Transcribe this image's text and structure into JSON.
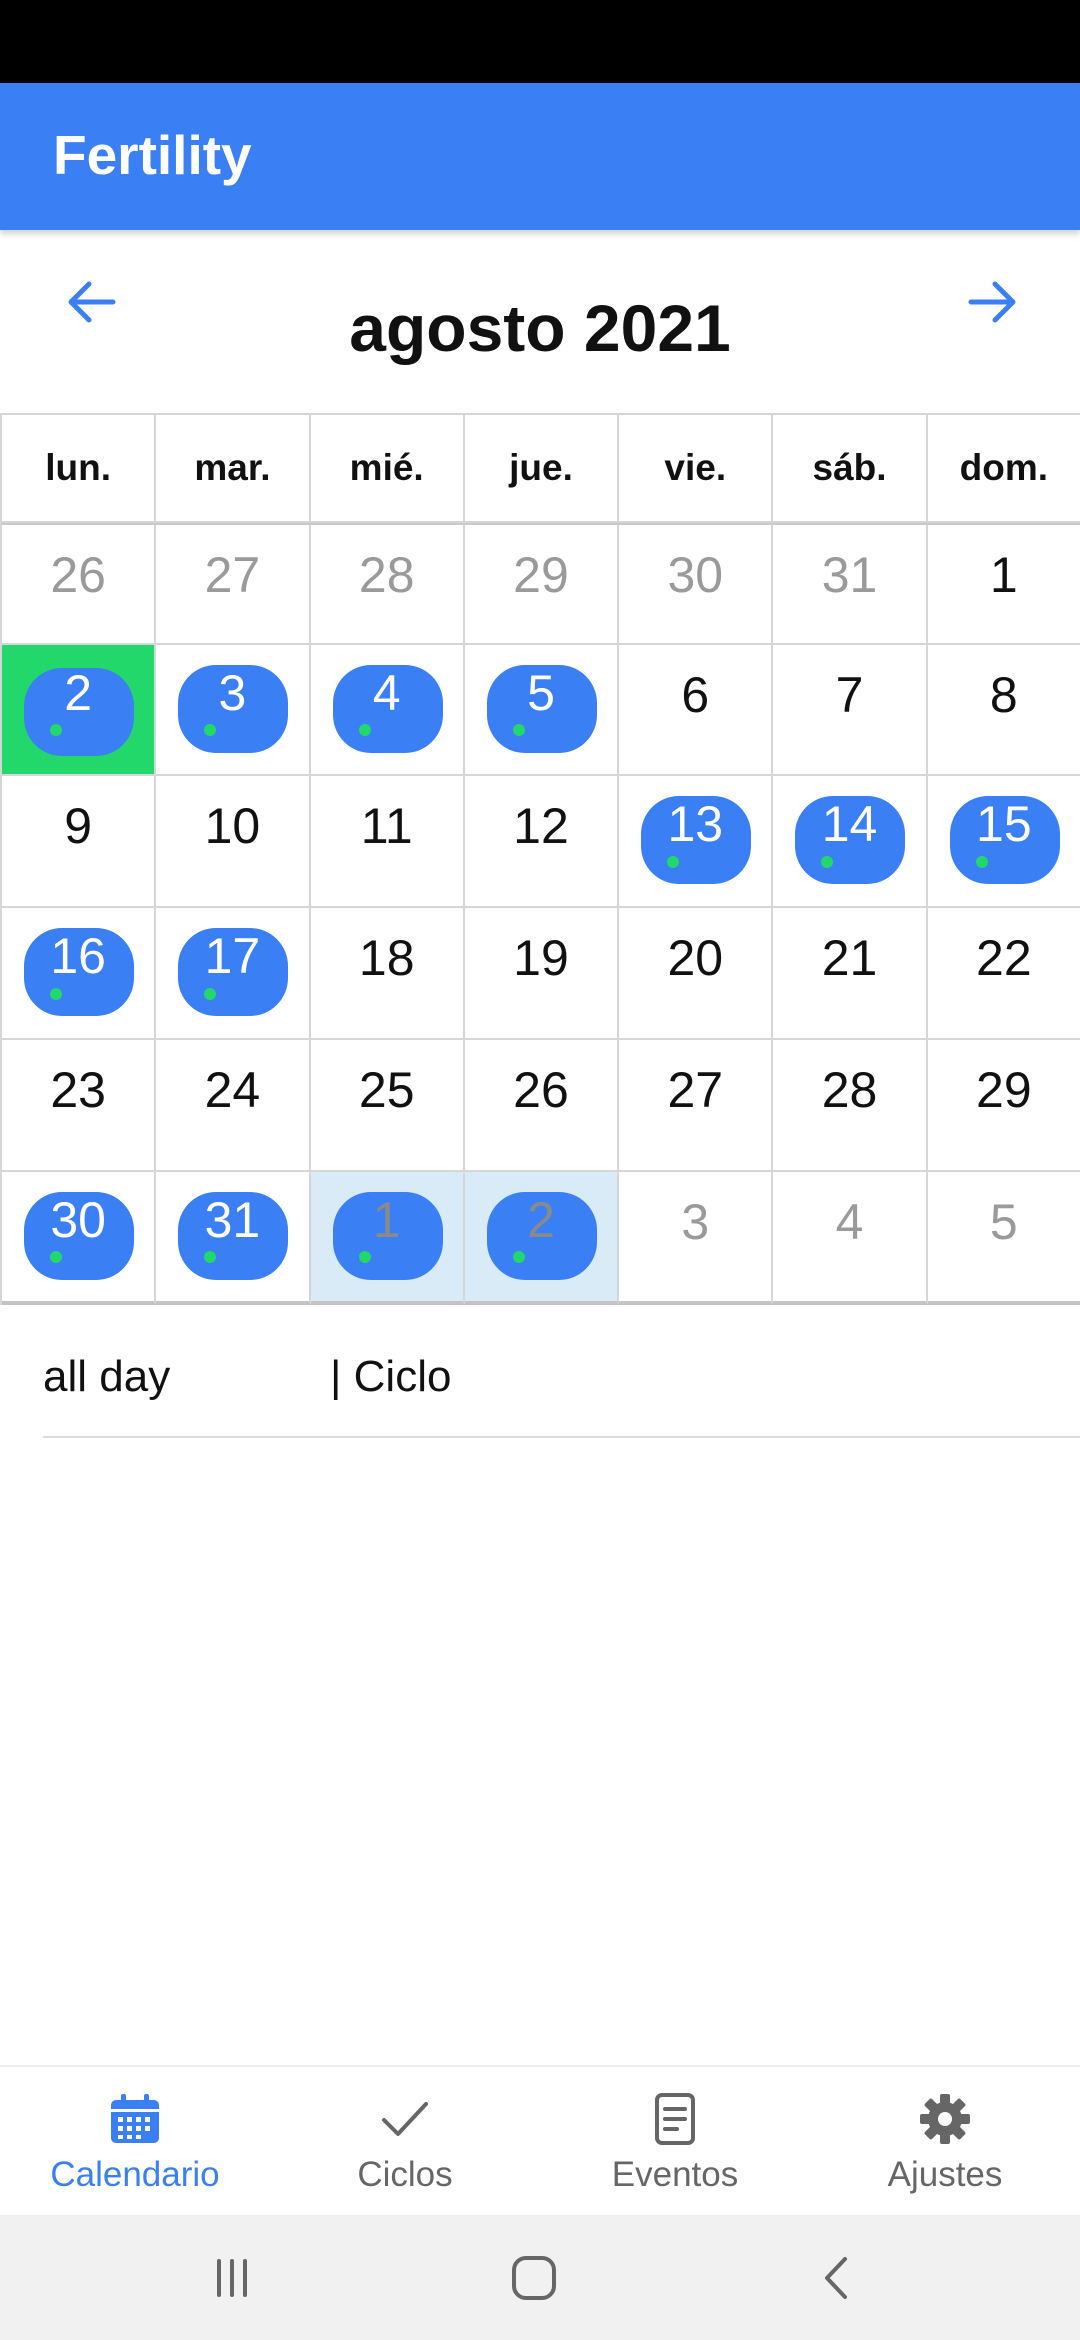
{
  "app": {
    "title": "Fertility"
  },
  "calendar": {
    "month_title": "agosto 2021",
    "weekdays": [
      "lun.",
      "mar.",
      "mié.",
      "jue.",
      "vie.",
      "sáb.",
      "dom."
    ],
    "weeks": [
      [
        {
          "d": "26",
          "muted": true
        },
        {
          "d": "27",
          "muted": true
        },
        {
          "d": "28",
          "muted": true
        },
        {
          "d": "29",
          "muted": true
        },
        {
          "d": "30",
          "muted": true
        },
        {
          "d": "31",
          "muted": true
        },
        {
          "d": "1"
        }
      ],
      [
        {
          "d": "2",
          "pill": true,
          "today": true
        },
        {
          "d": "3",
          "pill": true
        },
        {
          "d": "4",
          "pill": true
        },
        {
          "d": "5",
          "pill": true
        },
        {
          "d": "6"
        },
        {
          "d": "7"
        },
        {
          "d": "8"
        }
      ],
      [
        {
          "d": "9"
        },
        {
          "d": "10"
        },
        {
          "d": "11"
        },
        {
          "d": "12"
        },
        {
          "d": "13",
          "pill": true
        },
        {
          "d": "14",
          "pill": true
        },
        {
          "d": "15",
          "pill": true
        }
      ],
      [
        {
          "d": "16",
          "pill": true
        },
        {
          "d": "17",
          "pill": true
        },
        {
          "d": "18"
        },
        {
          "d": "19"
        },
        {
          "d": "20"
        },
        {
          "d": "21"
        },
        {
          "d": "22"
        }
      ],
      [
        {
          "d": "23"
        },
        {
          "d": "24"
        },
        {
          "d": "25"
        },
        {
          "d": "26"
        },
        {
          "d": "27"
        },
        {
          "d": "28"
        },
        {
          "d": "29"
        }
      ],
      [
        {
          "d": "30",
          "pill": true
        },
        {
          "d": "31",
          "pill": true
        },
        {
          "d": "1",
          "pill": true,
          "muted": true,
          "range": true
        },
        {
          "d": "2",
          "pill": true,
          "muted": true,
          "range": true
        },
        {
          "d": "3",
          "muted": true
        },
        {
          "d": "4",
          "muted": true
        },
        {
          "d": "5",
          "muted": true
        }
      ]
    ]
  },
  "event": {
    "time": "all day",
    "title": "| Ciclo"
  },
  "bottom_nav": [
    {
      "label": "Calendario",
      "icon": "calendar-icon",
      "active": true
    },
    {
      "label": "Ciclos",
      "icon": "check-icon",
      "active": false
    },
    {
      "label": "Eventos",
      "icon": "document-icon",
      "active": false
    },
    {
      "label": "Ajustes",
      "icon": "gear-icon",
      "active": false
    }
  ],
  "colors": {
    "primary": "#3b7ff5",
    "today": "#22d86a",
    "range": "#d8ebf6",
    "dot": "#22d86a"
  }
}
